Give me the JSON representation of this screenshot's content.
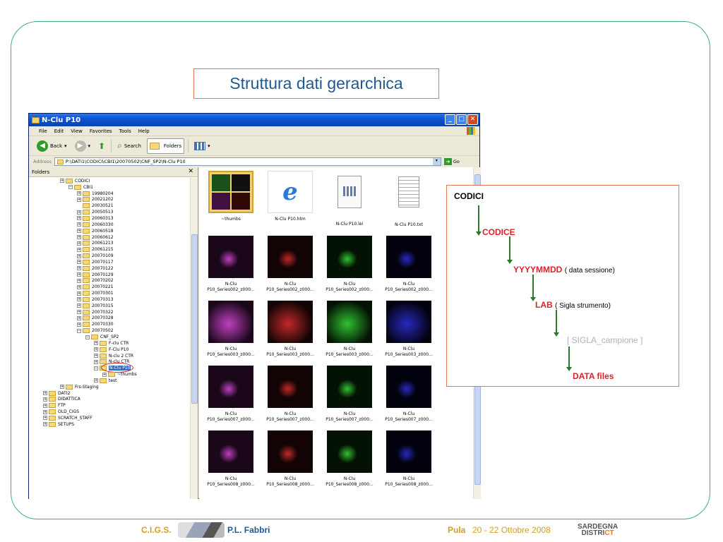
{
  "slide_title": "Struttura dati gerarchica",
  "window": {
    "title": "N-Clu P10",
    "menu": [
      "File",
      "Edit",
      "View",
      "Favorites",
      "Tools",
      "Help"
    ],
    "toolbar": {
      "back": "Back",
      "search": "Search",
      "folders": "Folders"
    },
    "address_label": "Address",
    "address": "P:\\DATI1\\CODICI\\CBI1\\20070502\\CNF_SP2\\N-Clu P10",
    "go": "Go",
    "folders_label": "Folders"
  },
  "tree": [
    {
      "label": "CODICI",
      "level": 3,
      "pm": "+"
    },
    {
      "label": "CBI1",
      "level": 4,
      "pm": "-"
    },
    {
      "label": "19980204",
      "level": 5,
      "pm": "+"
    },
    {
      "label": "20021202",
      "level": 5,
      "pm": "+"
    },
    {
      "label": "20030521",
      "level": 5,
      "pm": ""
    },
    {
      "label": "20050513",
      "level": 5,
      "pm": "+"
    },
    {
      "label": "20060313",
      "level": 5,
      "pm": "+"
    },
    {
      "label": "20060330",
      "level": 5,
      "pm": "+"
    },
    {
      "label": "20060518",
      "level": 5,
      "pm": "+"
    },
    {
      "label": "20060612",
      "level": 5,
      "pm": "+"
    },
    {
      "label": "20061213",
      "level": 5,
      "pm": "+"
    },
    {
      "label": "20061215",
      "level": 5,
      "pm": "+"
    },
    {
      "label": "20070109",
      "level": 5,
      "pm": "+"
    },
    {
      "label": "20070117",
      "level": 5,
      "pm": "+"
    },
    {
      "label": "20070122",
      "level": 5,
      "pm": "+"
    },
    {
      "label": "20070129",
      "level": 5,
      "pm": "+"
    },
    {
      "label": "20070202",
      "level": 5,
      "pm": "+"
    },
    {
      "label": "20070221",
      "level": 5,
      "pm": "+"
    },
    {
      "label": "20070301",
      "level": 5,
      "pm": "+"
    },
    {
      "label": "20070313",
      "level": 5,
      "pm": "+"
    },
    {
      "label": "20070315",
      "level": 5,
      "pm": "+"
    },
    {
      "label": "20070322",
      "level": 5,
      "pm": "+"
    },
    {
      "label": "20070328",
      "level": 5,
      "pm": "+"
    },
    {
      "label": "20070330",
      "level": 5,
      "pm": "+"
    },
    {
      "label": "20070502",
      "level": 5,
      "pm": "-"
    },
    {
      "label": "CNF_SP2",
      "level": 6,
      "pm": "-"
    },
    {
      "label": "F-clu CTR",
      "level": 7,
      "pm": "+"
    },
    {
      "label": "F-Clu P10",
      "level": 7,
      "pm": "+"
    },
    {
      "label": "N-clu 2 CTR",
      "level": 7,
      "pm": "+"
    },
    {
      "label": "N-clu CTR",
      "level": 7,
      "pm": "+"
    },
    {
      "label": "N-Clu P10",
      "level": 7,
      "pm": "-",
      "selected": true
    },
    {
      "label": "~thumbs",
      "level": 8,
      "pm": "+"
    },
    {
      "label": "test",
      "level": 7,
      "pm": "+"
    },
    {
      "label": "Frs-Staging",
      "level": 3,
      "pm": "+"
    },
    {
      "label": "DATI2",
      "level": 1,
      "pm": "+"
    },
    {
      "label": "DIDATTICA",
      "level": 1,
      "pm": "+"
    },
    {
      "label": "FTP",
      "level": 1,
      "pm": "+"
    },
    {
      "label": "OLD_CIGS",
      "level": 1,
      "pm": "+"
    },
    {
      "label": "SCRATCH_STAFF",
      "level": 1,
      "pm": "+"
    },
    {
      "label": "SETUPS",
      "level": 1,
      "pm": "+"
    }
  ],
  "files": [
    {
      "name": "~thumbs",
      "kind": "folder"
    },
    {
      "name": "N-Clu P10.htm",
      "kind": "ie"
    },
    {
      "name": "N-Clu P10.lei",
      "kind": "lei"
    },
    {
      "name": "N-Clu P10.txt",
      "kind": "txt"
    },
    {
      "name": "N-Clu P10_Series002_z000...",
      "kind": "magenta"
    },
    {
      "name": "N-Clu P10_Series002_z000...",
      "kind": "red"
    },
    {
      "name": "N-Clu P10_Series002_z000...",
      "kind": "green"
    },
    {
      "name": "N-Clu P10_Series002_z000...",
      "kind": "blue"
    },
    {
      "name": "N-Clu P10_Series003_z000...",
      "kind": "magenta"
    },
    {
      "name": "N-Clu P10_Series003_z000...",
      "kind": "red"
    },
    {
      "name": "N-Clu P10_Series003_z000...",
      "kind": "green"
    },
    {
      "name": "N-Clu P10_Series003_z000...",
      "kind": "blue"
    },
    {
      "name": "N-Clu P10_Series007_z000...",
      "kind": "magenta"
    },
    {
      "name": "N-Clu P10_Series007_z000...",
      "kind": "red"
    },
    {
      "name": "N-Clu P10_Series007_z000...",
      "kind": "green"
    },
    {
      "name": "N-Clu P10_Series007_z000...",
      "kind": "blue"
    },
    {
      "name": "N-Clu P10_Series008_z000...",
      "kind": "magenta"
    },
    {
      "name": "N-Clu P10_Series008_z000...",
      "kind": "red"
    },
    {
      "name": "N-Clu P10_Series008_z000...",
      "kind": "green"
    },
    {
      "name": "N-Clu P10_Series008_z000...",
      "kind": "blue"
    }
  ],
  "diagram": {
    "codici": "CODICI",
    "codice": "CODICE",
    "date": "YYYYMMDD",
    "date_note": "( data sessione)",
    "lab": "LAB",
    "lab_note": "( Sigla strumento)",
    "sigla": "[ SIGLA_campione ]",
    "data_files": "DATA files"
  },
  "footer": {
    "org": "C.I.G.S.",
    "author": "P.L. Fabbri",
    "place": "Pula",
    "dates": "20 - 22 Ottobre 2008",
    "district_1": "SARDEGNA",
    "district_2a": "DISTRI",
    "district_2b": "CT"
  },
  "colors": {
    "title": "#1e5a91",
    "red": "#e0202a",
    "gray": "#b0b0b0",
    "green": "#3fae7a"
  }
}
